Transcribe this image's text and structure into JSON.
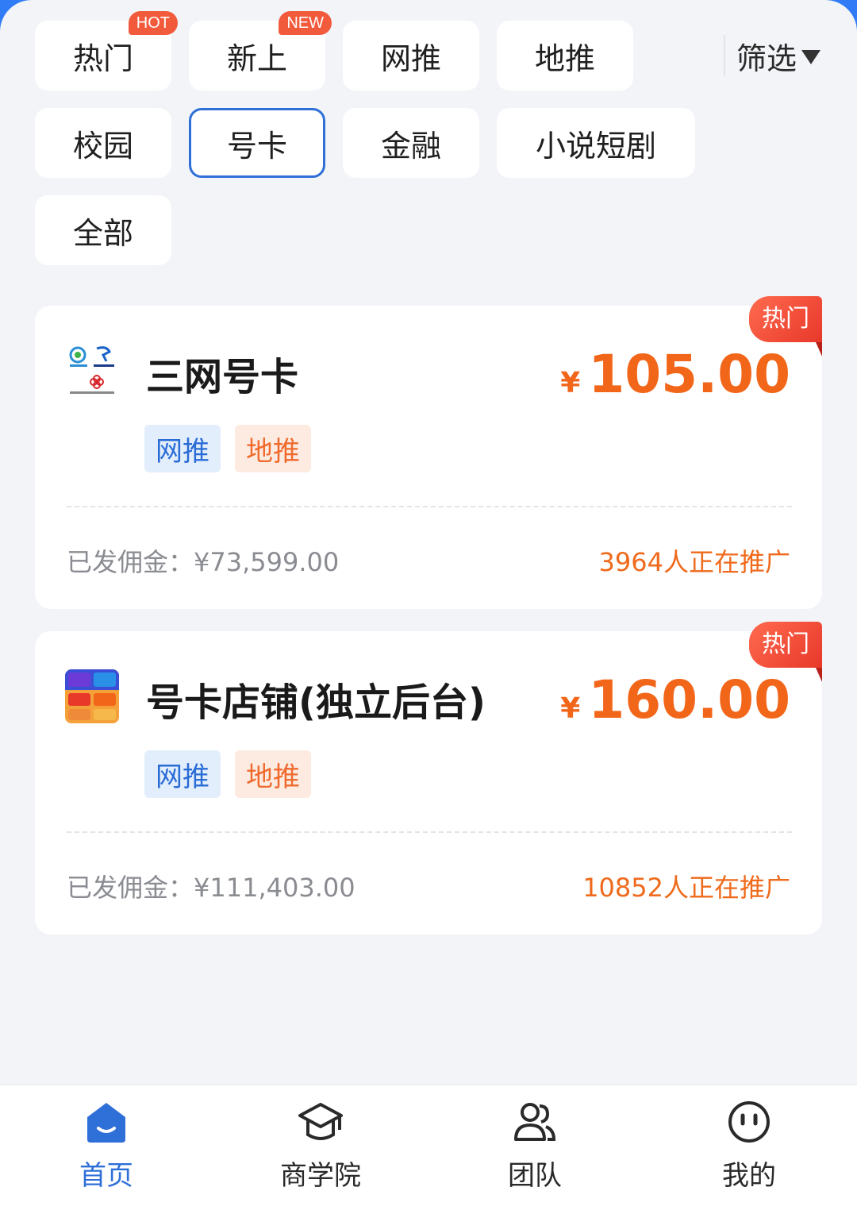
{
  "categories": [
    {
      "label": "热门",
      "badge": "HOT"
    },
    {
      "label": "新上",
      "badge": "NEW"
    },
    {
      "label": "网推"
    },
    {
      "label": "地推"
    },
    {
      "label": "校园"
    },
    {
      "label": "号卡",
      "active": true
    },
    {
      "label": "金融"
    },
    {
      "label": "小说短剧"
    },
    {
      "label": "全部"
    }
  ],
  "filter": {
    "label": "筛选"
  },
  "products": [
    {
      "hot_label": "热门",
      "title": "三网号卡",
      "currency": "¥",
      "price": "105.00",
      "tags": [
        "网推",
        "地推"
      ],
      "commission": "已发佣金：¥73,599.00",
      "promoting": "3964人正在推广"
    },
    {
      "hot_label": "热门",
      "title": "号卡店铺(独立后台)",
      "currency": "¥",
      "price": "160.00",
      "tags": [
        "网推",
        "地推"
      ],
      "commission": "已发佣金：¥111,403.00",
      "promoting": "10852人正在推广"
    }
  ],
  "nav": [
    {
      "label": "首页",
      "icon": "home-icon",
      "active": true
    },
    {
      "label": "商学院",
      "icon": "graduation-cap-icon"
    },
    {
      "label": "团队",
      "icon": "team-icon"
    },
    {
      "label": "我的",
      "icon": "smiley-icon"
    }
  ],
  "colors": {
    "accent": "#2f6fd8",
    "price": "#f2661a",
    "hot": "#e8382a"
  }
}
